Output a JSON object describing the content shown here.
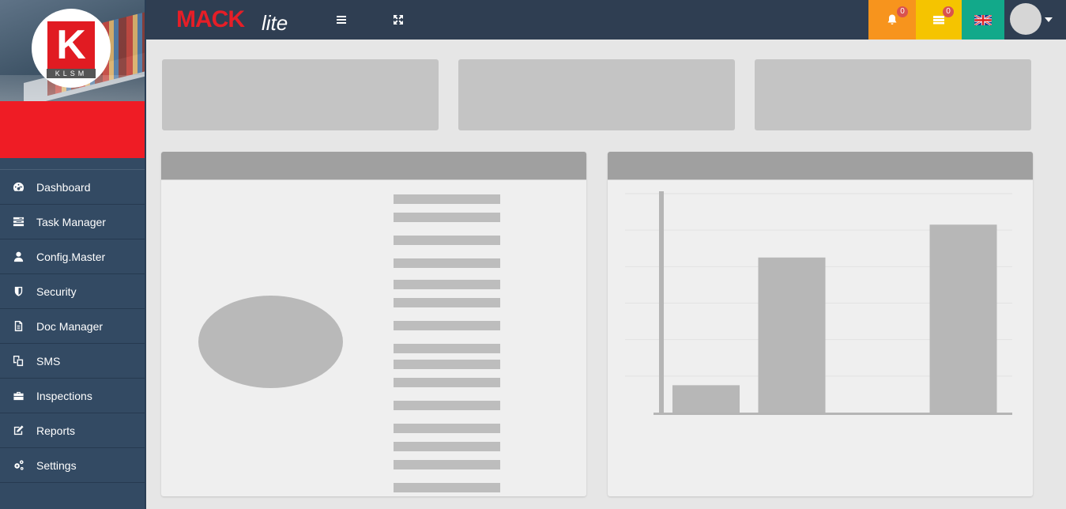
{
  "app": {
    "brand_main": "MACK",
    "brand_sub": "lite",
    "logo_letter": "K",
    "logo_text": "KLSM"
  },
  "sidebar": {
    "items": [
      {
        "label": "Dashboard",
        "icon": "dashboard-icon"
      },
      {
        "label": "Task Manager",
        "icon": "tasks-icon"
      },
      {
        "label": "Config.Master",
        "icon": "user-icon"
      },
      {
        "label": "Security",
        "icon": "shield-icon"
      },
      {
        "label": "Doc Manager",
        "icon": "document-icon"
      },
      {
        "label": "SMS",
        "icon": "copy-icon"
      },
      {
        "label": "Inspections",
        "icon": "briefcase-icon"
      },
      {
        "label": "Reports",
        "icon": "edit-icon"
      },
      {
        "label": "Settings",
        "icon": "cogs-icon"
      }
    ]
  },
  "topbar": {
    "notifications_count": "0",
    "messages_count": "0",
    "language": "en-GB",
    "colors": {
      "notifications": "#f7941d",
      "messages": "#f5c400",
      "language": "#12a98a"
    }
  },
  "chart_data": {
    "type": "bar",
    "categories": [
      "",
      "",
      "",
      ""
    ],
    "values": [
      15,
      85,
      0,
      103
    ],
    "ylim": [
      0,
      120
    ],
    "grid": true
  }
}
